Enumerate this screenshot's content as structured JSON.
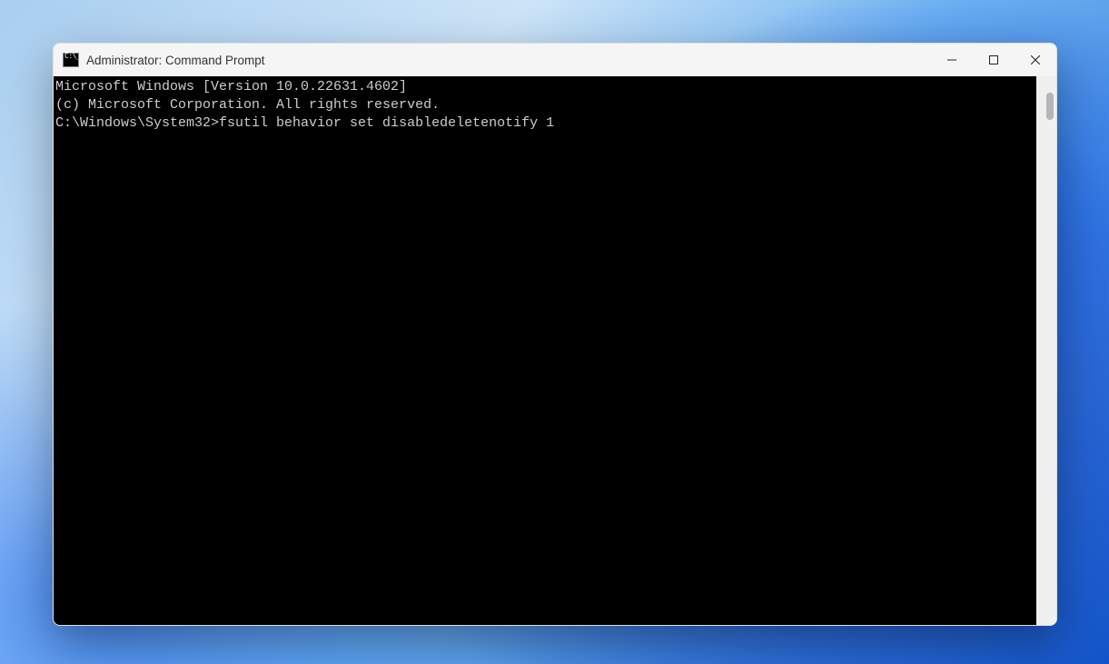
{
  "window": {
    "title": "Administrator: Command Prompt"
  },
  "terminal": {
    "line1": "Microsoft Windows [Version 10.0.22631.4602]",
    "line2": "(c) Microsoft Corporation. All rights reserved.",
    "blank": "",
    "prompt": "C:\\Windows\\System32>",
    "command": "fsutil behavior set disabledeletenotify 1"
  }
}
